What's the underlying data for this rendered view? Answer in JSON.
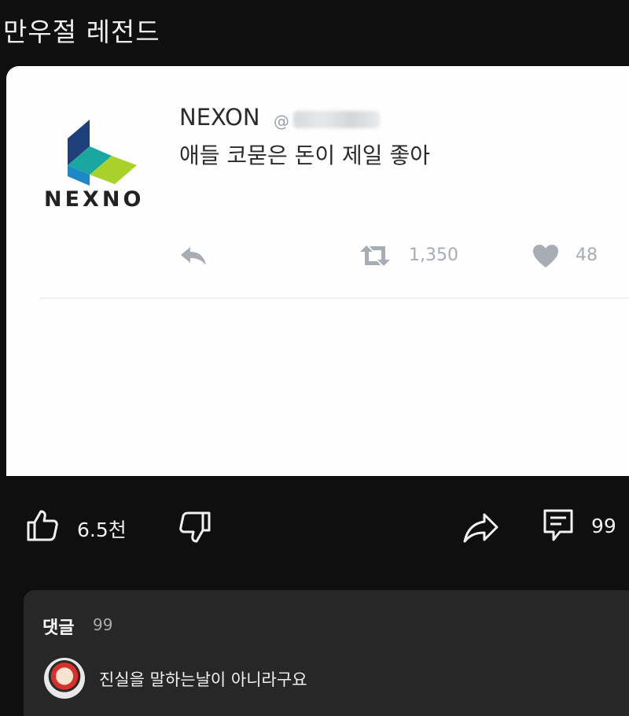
{
  "video": {
    "title": "만우절 레전드"
  },
  "tweet": {
    "logo_text": "NEXNO",
    "display_name": "NEXON",
    "handle_prefix": "@",
    "text": "애들 코묻은 돈이 제일 좋아",
    "retweets": "1,350",
    "likes": "48"
  },
  "actions": {
    "like_count": "6.5천",
    "comment_count": "99"
  },
  "comments": {
    "label": "댓글",
    "count": "99",
    "first_comment": "진실을 말하는날이 아니라구요"
  },
  "colors": {
    "background": "#0f0f0f",
    "card": "#fefefe",
    "panel": "#272727",
    "tweet_icon": "#a6adb4",
    "logo_dark_blue": "#1d3f7a",
    "logo_teal": "#1aa7a0",
    "logo_lime": "#a8d12a"
  },
  "icons": {
    "tweet_reply": "reply-arrow-icon",
    "tweet_retweet": "retweet-icon",
    "tweet_like": "heart-icon",
    "like": "thumbs-up-icon",
    "dislike": "thumbs-down-icon",
    "share": "share-arrow-icon",
    "comment": "comment-bubble-icon"
  }
}
